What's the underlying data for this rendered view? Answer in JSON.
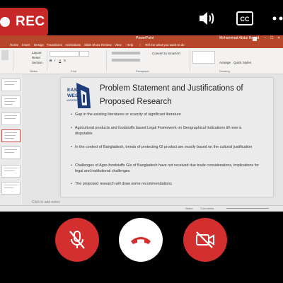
{
  "call": {
    "rec_label": "REC",
    "top_icons": [
      "volume-icon",
      "closed-captions-icon",
      "more-icon"
    ],
    "controls": [
      "mic-muted-icon",
      "hang-up-icon",
      "camera-off-icon"
    ],
    "colors": {
      "rec": "#c62828",
      "control_red": "#d32f2f",
      "hang_bg": "#ffffff"
    }
  },
  "ppt": {
    "app_title": "PowerPoint",
    "search_text": "Tell me what you want to do",
    "user": "Mohammad Abdul Hamid",
    "tabs": [
      "Home",
      "Insert",
      "Design",
      "Transitions",
      "Animations",
      "Slide Show",
      "Review",
      "View",
      "Help"
    ],
    "ribbon": {
      "layout": "Layout",
      "reset": "Reset",
      "section": "Section",
      "paste": "Paste",
      "new_slide": "New Slide",
      "groups": [
        "Slides",
        "Font",
        "Paragraph",
        "Drawing"
      ],
      "convert": "Convert to SmartArt",
      "arrange": "Arrange",
      "quick_styles": "Quick Styles"
    },
    "notes_placeholder": "Click to add notes",
    "status": {
      "notes": "Notes",
      "comments": "Comments"
    },
    "slide": {
      "logo_text": [
        "EAST",
        "WEST",
        "UNIVERSITY"
      ],
      "title": "Problem Statement and Justifications of Proposed Research",
      "bullets": [
        "Gap in the existing literatures or scarcity of significant literature",
        "Agricultural products and foodstuffs based Legal Framework on Geographical Indications till now is disputable",
        "In the context of Bangladesh, trends of protecting GI product are mostly based on the cultural justification",
        "Challenges of Agro-foodstuffs GIs of Bangladesh have not received due trade considerations, implications for legal and institutional challenges",
        "The proposed research will draw some recommendations"
      ]
    }
  }
}
